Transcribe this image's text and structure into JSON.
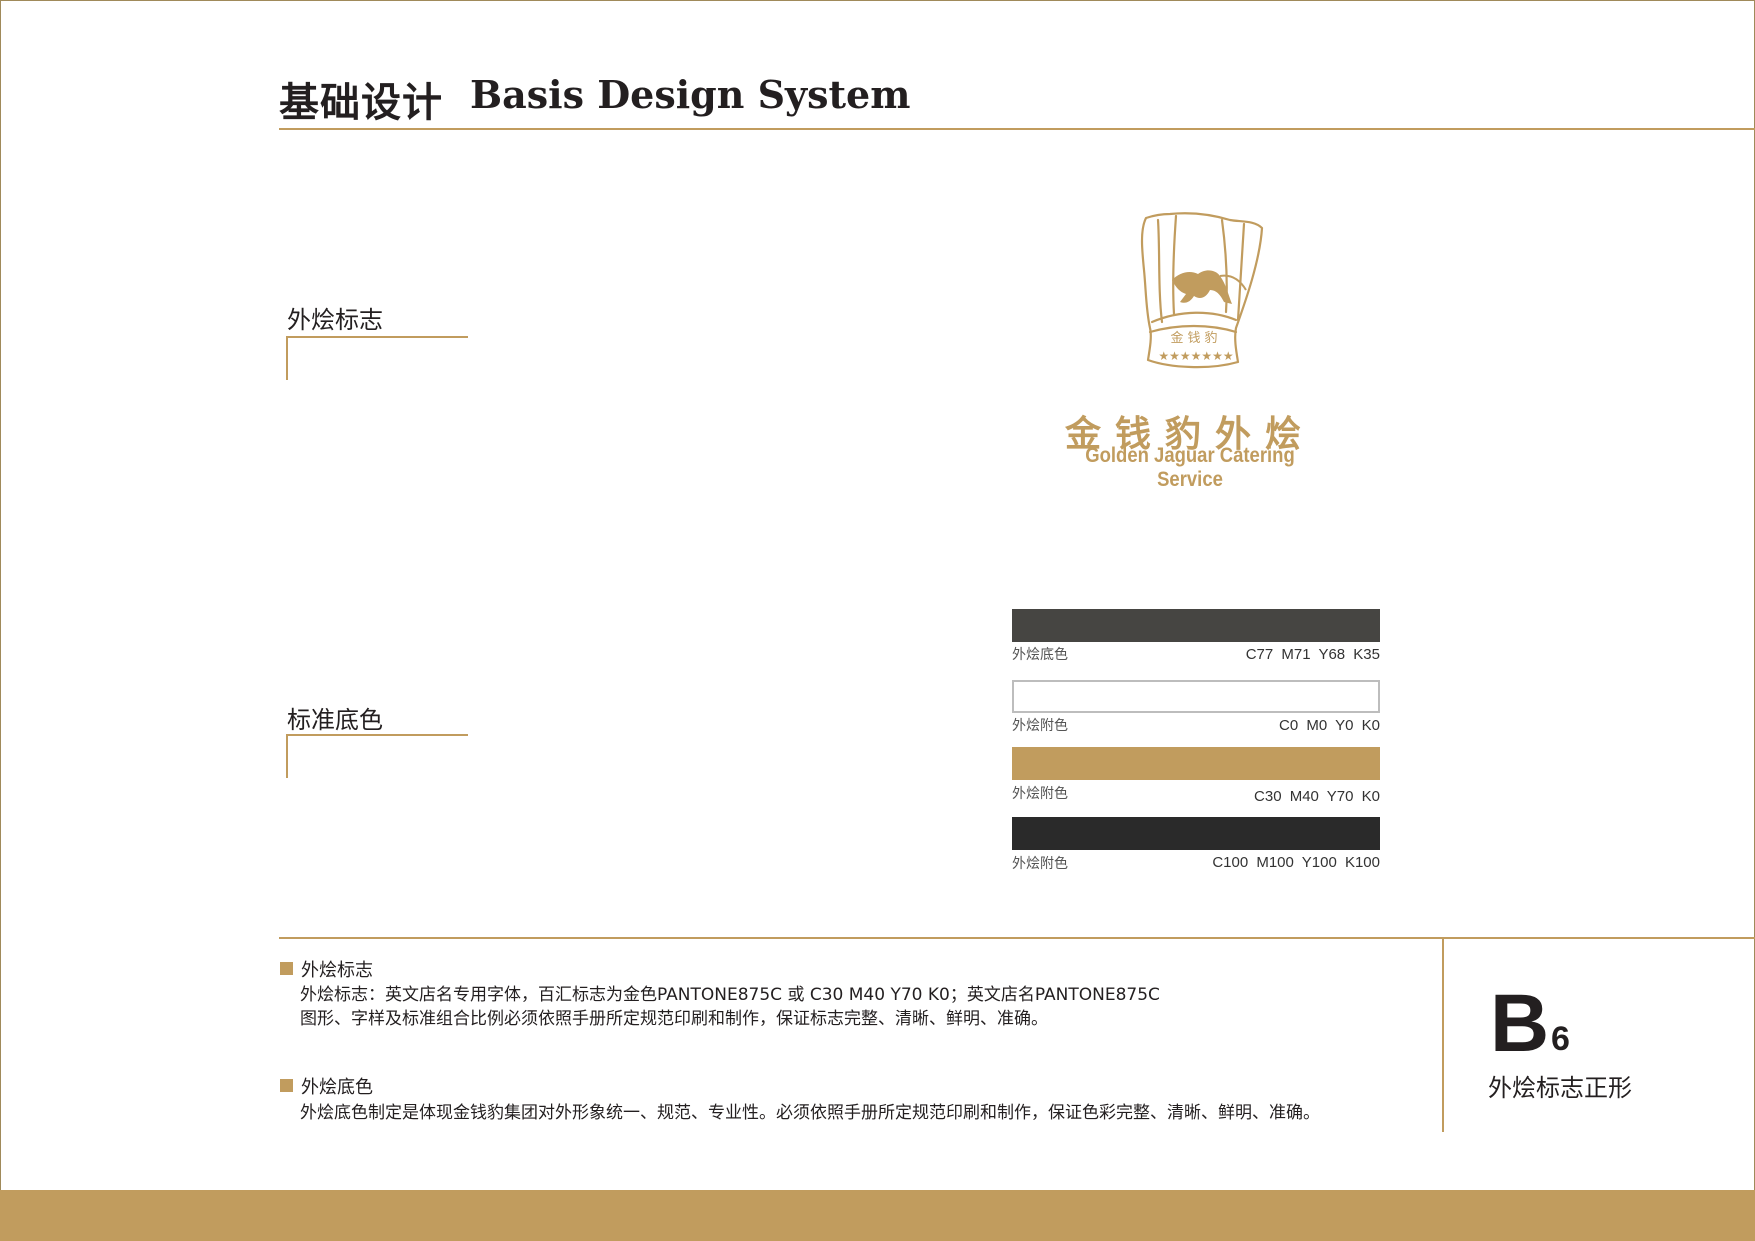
{
  "header": {
    "title_cn": "基础设计",
    "title_en": "Basis Design System"
  },
  "sections": {
    "logo_label": "外烩标志",
    "color_label": "标准底色"
  },
  "logo": {
    "hat_text": "金钱豹",
    "stars": "★★★★★★★",
    "name_cn": "金钱豹外烩",
    "name_en": "Golden Jaguar Catering Service"
  },
  "swatches": [
    {
      "label": "外烩底色",
      "code": "C77 M71 Y68 K35",
      "color": "#464542"
    },
    {
      "label": "外烩附色",
      "code": "C0 M0 Y0 K0",
      "color": "#ffffff"
    },
    {
      "label": "外烩附色",
      "code": "C30 M40 Y70 K0",
      "color": "#c19c5e"
    },
    {
      "label": "外烩附色",
      "code": "C100 M100 Y100 K100",
      "color": "#2a2a2a"
    }
  ],
  "notes": {
    "logo": {
      "title": "外烩标志",
      "line1": "外烩标志：英文店名专用字体，百汇标志为金色PANTONE875C 或 C30 M40 Y70 K0；英文店名PANTONE875C",
      "line2": "图形、字样及标准组合比例必须依照手册所定规范印刷和制作，保证标志完整、清晰、鲜明、准确。"
    },
    "color": {
      "title": "外烩底色",
      "line1": "外烩底色制定是体现金钱豹集团对外形象统一、规范、专业性。必须依照手册所定规范印刷和制作，保证色彩完整、清晰、鲜明、准确。"
    }
  },
  "page_code": {
    "letter": "B",
    "number": "6",
    "caption": "外烩标志正形"
  },
  "colors": {
    "accent": "#c19c5e",
    "text": "#231f20"
  }
}
